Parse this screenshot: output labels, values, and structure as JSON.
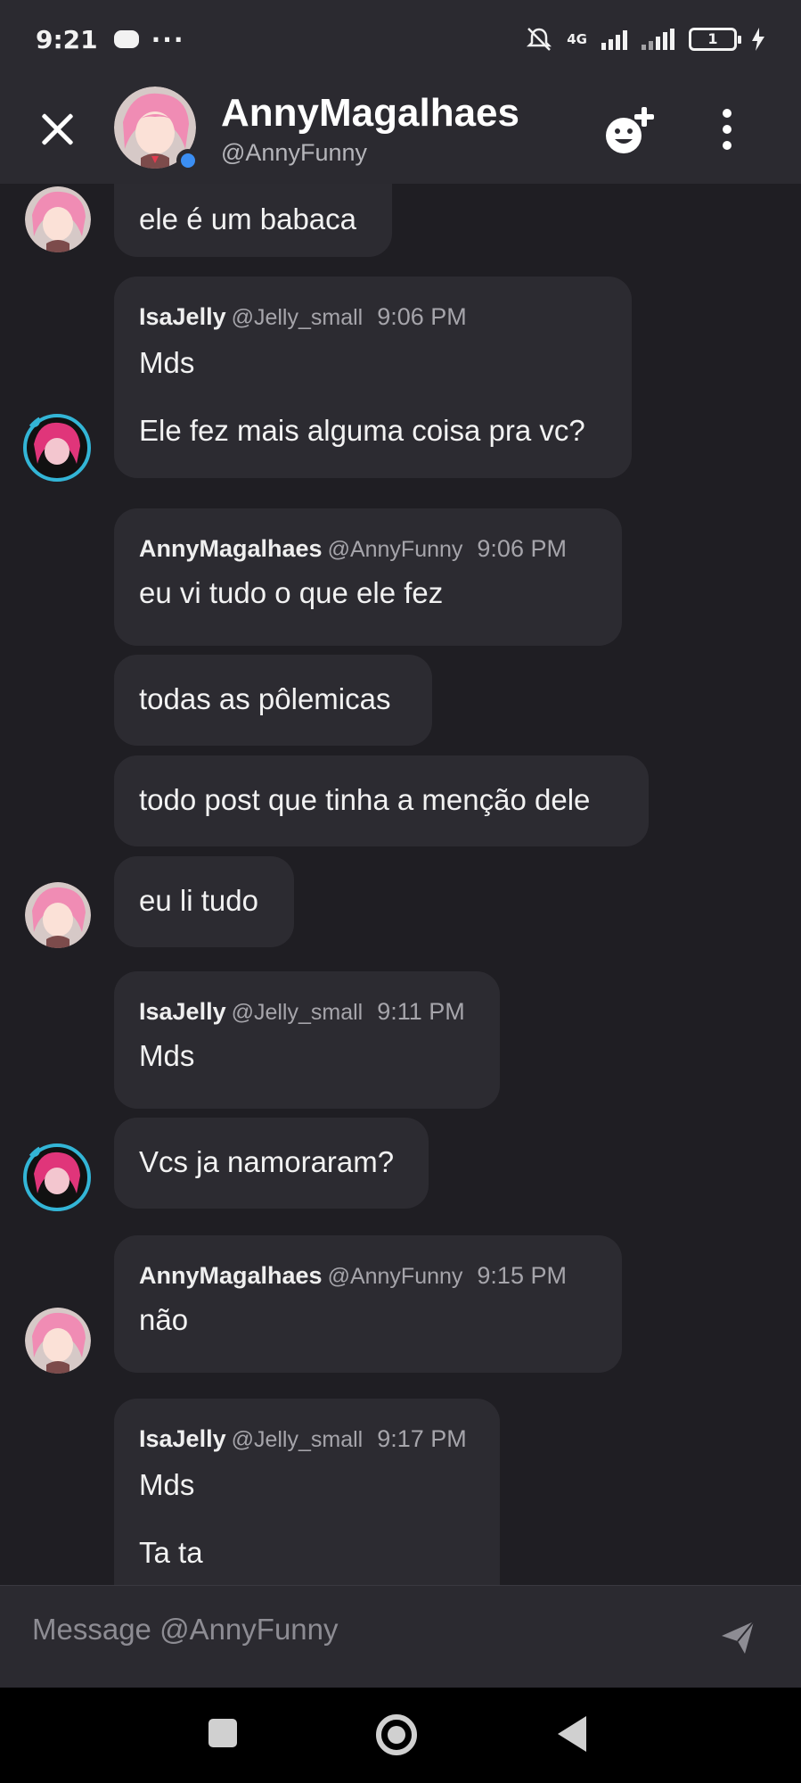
{
  "status_bar": {
    "time": "9:21",
    "dots": "···",
    "network": "4G",
    "battery": "1"
  },
  "header": {
    "name": "AnnyMagalhaes",
    "handle": "@AnnyFunny"
  },
  "messages": {
    "m0": {
      "lines": [
        "ele é um babaca"
      ]
    },
    "m1": {
      "author": "IsaJelly",
      "handle": "@Jelly_small",
      "time": "9:06 PM",
      "lines": [
        "Mds",
        "Ele fez mais alguma coisa pra vc?"
      ]
    },
    "m2": {
      "author": "AnnyMagalhaes",
      "handle": "@AnnyFunny",
      "time": "9:06 PM",
      "lines": [
        "eu vi tudo o que ele fez"
      ]
    },
    "m3": {
      "lines": [
        "todas as pôlemicas"
      ]
    },
    "m4": {
      "lines": [
        "todo post que tinha a menção dele"
      ]
    },
    "m5": {
      "lines": [
        "eu li tudo"
      ]
    },
    "m6": {
      "author": "IsaJelly",
      "handle": "@Jelly_small",
      "time": "9:11 PM",
      "lines": [
        "Mds"
      ]
    },
    "m7": {
      "lines": [
        "Vcs ja namoraram?"
      ]
    },
    "m8": {
      "author": "AnnyMagalhaes",
      "handle": "@AnnyFunny",
      "time": "9:15 PM",
      "lines": [
        "não"
      ]
    },
    "m9": {
      "author": "IsaJelly",
      "handle": "@Jelly_small",
      "time": "9:17 PM",
      "lines": [
        "Mds",
        "Ta ta"
      ]
    }
  },
  "composer": {
    "placeholder": "Message @AnnyFunny"
  },
  "icons": {
    "close": "close-icon",
    "emoji_add": "emoji-add-icon",
    "more": "more-vertical-icon",
    "send": "send-icon",
    "mute": "bell-muted-icon",
    "discord": "discord-icon"
  },
  "colors": {
    "background": "#1f1e23",
    "bubble": "#2c2b31",
    "header": "#2b2a30",
    "online": "#3b8ef3",
    "avatar_ring": "#33b5d6"
  }
}
